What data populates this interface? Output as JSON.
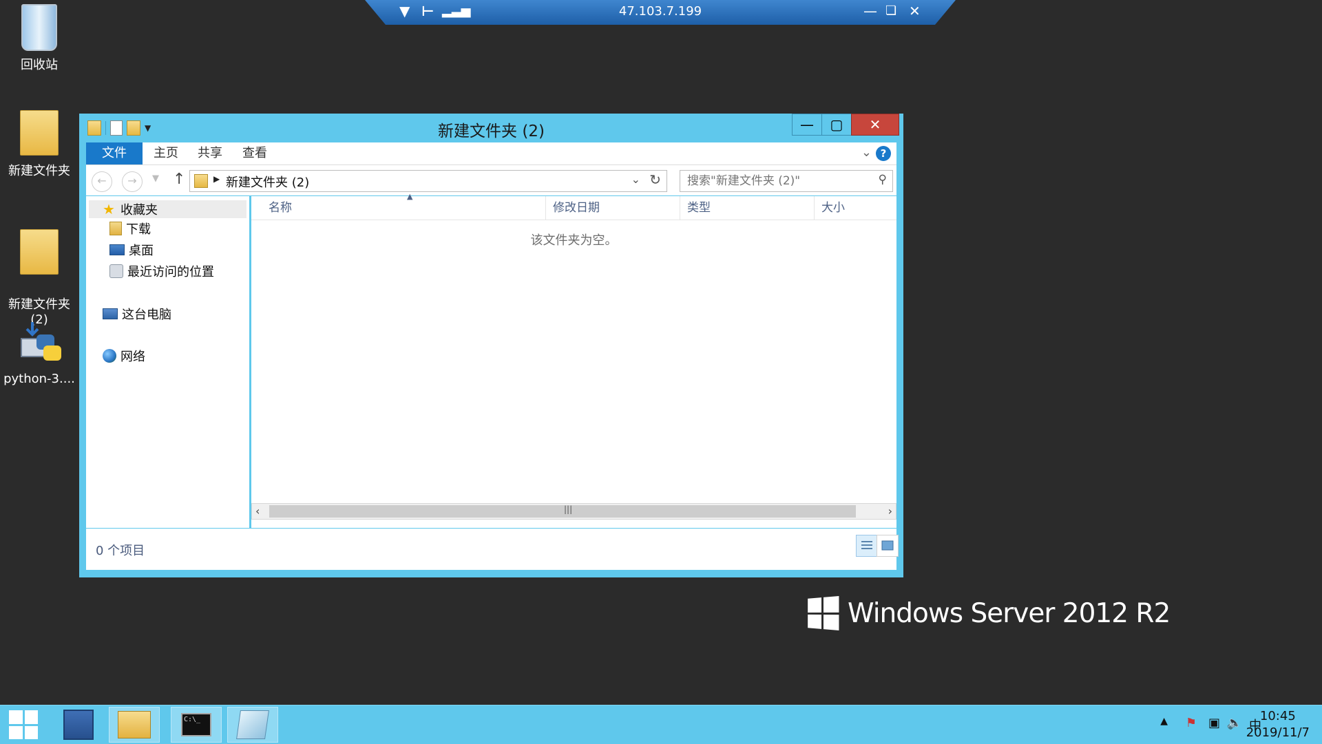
{
  "rdp_bar": {
    "ip": "47.103.7.199",
    "pin_icon": "pin-icon",
    "signal_icon": "signal-icon"
  },
  "desktop": {
    "icons": [
      {
        "label": "回收站",
        "icon": "recycle-bin-icon"
      },
      {
        "label": "新建文件夹",
        "icon": "folder-icon"
      },
      {
        "label": "新建文件夹\n(2)",
        "icon": "folder-icon"
      },
      {
        "label": "python-3....",
        "icon": "python-installer-icon"
      }
    ]
  },
  "window": {
    "title": "新建文件夹 (2)",
    "ribbon": {
      "tabs": [
        "文件",
        "主页",
        "共享",
        "查看"
      ]
    },
    "address": {
      "path": "新建文件夹 (2)"
    },
    "search": {
      "placeholder": "搜索\"新建文件夹 (2)\""
    },
    "sidebar": {
      "favorites": "收藏夹",
      "downloads": "下载",
      "desktop": "桌面",
      "recent": "最近访问的位置",
      "this_pc": "这台电脑",
      "network": "网络"
    },
    "columns": [
      "名称",
      "修改日期",
      "类型",
      "大小"
    ],
    "empty_message": "该文件夹为空。",
    "status": "0 个项目"
  },
  "branding": {
    "text": "Windows Server 2012 R2"
  },
  "taskbar": {
    "time": "10:45",
    "date": "2019/11/7",
    "ime": "中"
  },
  "colors": {
    "window_frame": "#5fc8ec",
    "taskbar": "#5fc8ec",
    "file_tab": "#1979ca",
    "close_button": "#c7463c",
    "desktop": "#2b2b2b"
  }
}
